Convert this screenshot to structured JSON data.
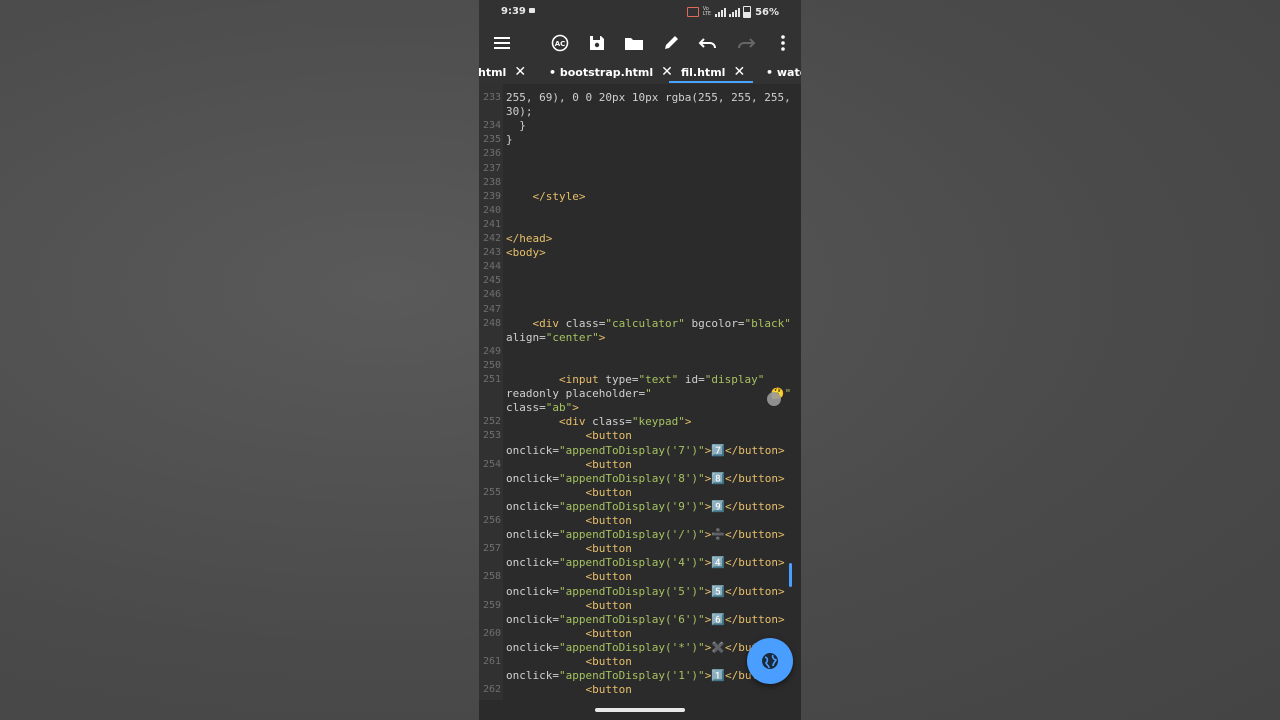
{
  "status": {
    "time": "9:39",
    "battery": "56%"
  },
  "toolbar": {
    "icons": [
      "menu-icon",
      "autocomplete-icon",
      "save-icon",
      "folder-icon",
      "pencil-icon",
      "undo-icon",
      "redo-icon",
      "more-icon"
    ]
  },
  "tabs": [
    {
      "label": "html"
    },
    {
      "label": "• bootstrap.html"
    },
    {
      "label": "fil.html"
    },
    {
      "label": "• watch"
    }
  ],
  "tab_close": "✕",
  "editor": {
    "lines": [
      {
        "n": "233",
        "t": "255, 69), 0 0 20px 10px rgba(255, 255, 255,"
      },
      {
        "n": "",
        "t": "30);"
      },
      {
        "n": "234",
        "t": "  }"
      },
      {
        "n": "235",
        "t": "}"
      },
      {
        "n": "236",
        "t": ""
      },
      {
        "n": "237",
        "t": ""
      },
      {
        "n": "238",
        "t": ""
      },
      {
        "n": "239",
        "t": "    </style>"
      },
      {
        "n": "240",
        "t": ""
      },
      {
        "n": "241",
        "t": ""
      },
      {
        "n": "242",
        "t": "</head>"
      },
      {
        "n": "243",
        "t": "<body>"
      },
      {
        "n": "244",
        "t": ""
      },
      {
        "n": "245",
        "t": ""
      },
      {
        "n": "246",
        "t": ""
      },
      {
        "n": "247",
        "t": ""
      },
      {
        "n": "248",
        "t": "    <div class=\"calculator\" bgcolor=\"black\""
      },
      {
        "n": "",
        "t": "align=\"center\">"
      },
      {
        "n": "249",
        "t": ""
      },
      {
        "n": "250",
        "t": ""
      },
      {
        "n": "251",
        "t": "        <input type=\"text\" id=\"display\""
      },
      {
        "n": "",
        "t": "readonly placeholder=\"                  🤔\""
      },
      {
        "n": "",
        "t": "class=\"ab\">"
      },
      {
        "n": "252",
        "t": "        <div class=\"keypad\">"
      },
      {
        "n": "253",
        "t": "            <button"
      },
      {
        "n": "",
        "t": "onclick=\"appendToDisplay('7')\">7️⃣</button>"
      },
      {
        "n": "254",
        "t": "            <button"
      },
      {
        "n": "",
        "t": "onclick=\"appendToDisplay('8')\">8️⃣</button>"
      },
      {
        "n": "255",
        "t": "            <button"
      },
      {
        "n": "",
        "t": "onclick=\"appendToDisplay('9')\">9️⃣</button>"
      },
      {
        "n": "256",
        "t": "            <button"
      },
      {
        "n": "",
        "t": "onclick=\"appendToDisplay('/')\">➗</button>"
      },
      {
        "n": "257",
        "t": "            <button"
      },
      {
        "n": "",
        "t": "onclick=\"appendToDisplay('4')\">4️⃣</button>"
      },
      {
        "n": "258",
        "t": "            <button"
      },
      {
        "n": "",
        "t": "onclick=\"appendToDisplay('5')\">5️⃣</button>"
      },
      {
        "n": "259",
        "t": "            <button"
      },
      {
        "n": "",
        "t": "onclick=\"appendToDisplay('6')\">6️⃣</button>"
      },
      {
        "n": "260",
        "t": "            <button"
      },
      {
        "n": "",
        "t": "onclick=\"appendToDisplay('*')\">✖️</button>"
      },
      {
        "n": "261",
        "t": "            <button"
      },
      {
        "n": "",
        "t": "onclick=\"appendToDisplay('1')\">1️⃣</button>"
      },
      {
        "n": "262",
        "t": "            <button"
      }
    ]
  }
}
